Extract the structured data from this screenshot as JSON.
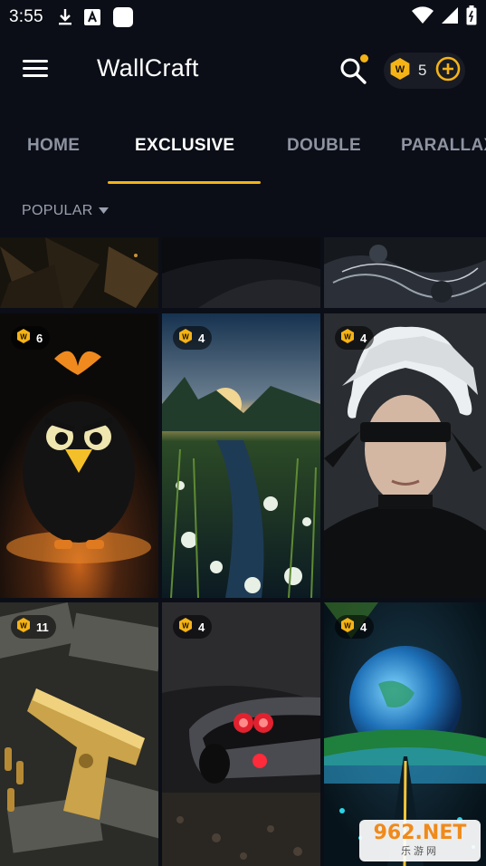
{
  "status_bar": {
    "time": "3:55",
    "icons": [
      "download-icon",
      "font-a-icon",
      "square-app-icon",
      "wifi-icon",
      "signal-icon",
      "battery-icon"
    ]
  },
  "app_bar": {
    "title": "WallCraft",
    "coins": "5",
    "icons": [
      "menu-icon",
      "search-icon",
      "coin-icon",
      "add-circle-icon"
    ]
  },
  "tabs": [
    {
      "label": "HOME",
      "active": false
    },
    {
      "label": "EXCLUSIVE",
      "active": true
    },
    {
      "label": "DOUBLE",
      "active": false
    },
    {
      "label": "PARALLAX",
      "active": false
    }
  ],
  "sort": {
    "label": "POPULAR"
  },
  "wallpapers": [
    {
      "price": "6",
      "subject": "black cartoon bird"
    },
    {
      "price": "4",
      "subject": "flower meadow at sunset"
    },
    {
      "price": "4",
      "subject": "white-haired blindfolded character"
    },
    {
      "price": "11",
      "subject": "golden pistol on banknotes"
    },
    {
      "price": "4",
      "subject": "dark sports car with red lights"
    },
    {
      "price": "4",
      "subject": "planet over neon road"
    }
  ],
  "watermark": {
    "main": "962.NET",
    "sub": "乐游网"
  },
  "colors": {
    "accent": "#f5b316",
    "background": "#0b0e17",
    "inactive_tab": "#8d93a1"
  }
}
